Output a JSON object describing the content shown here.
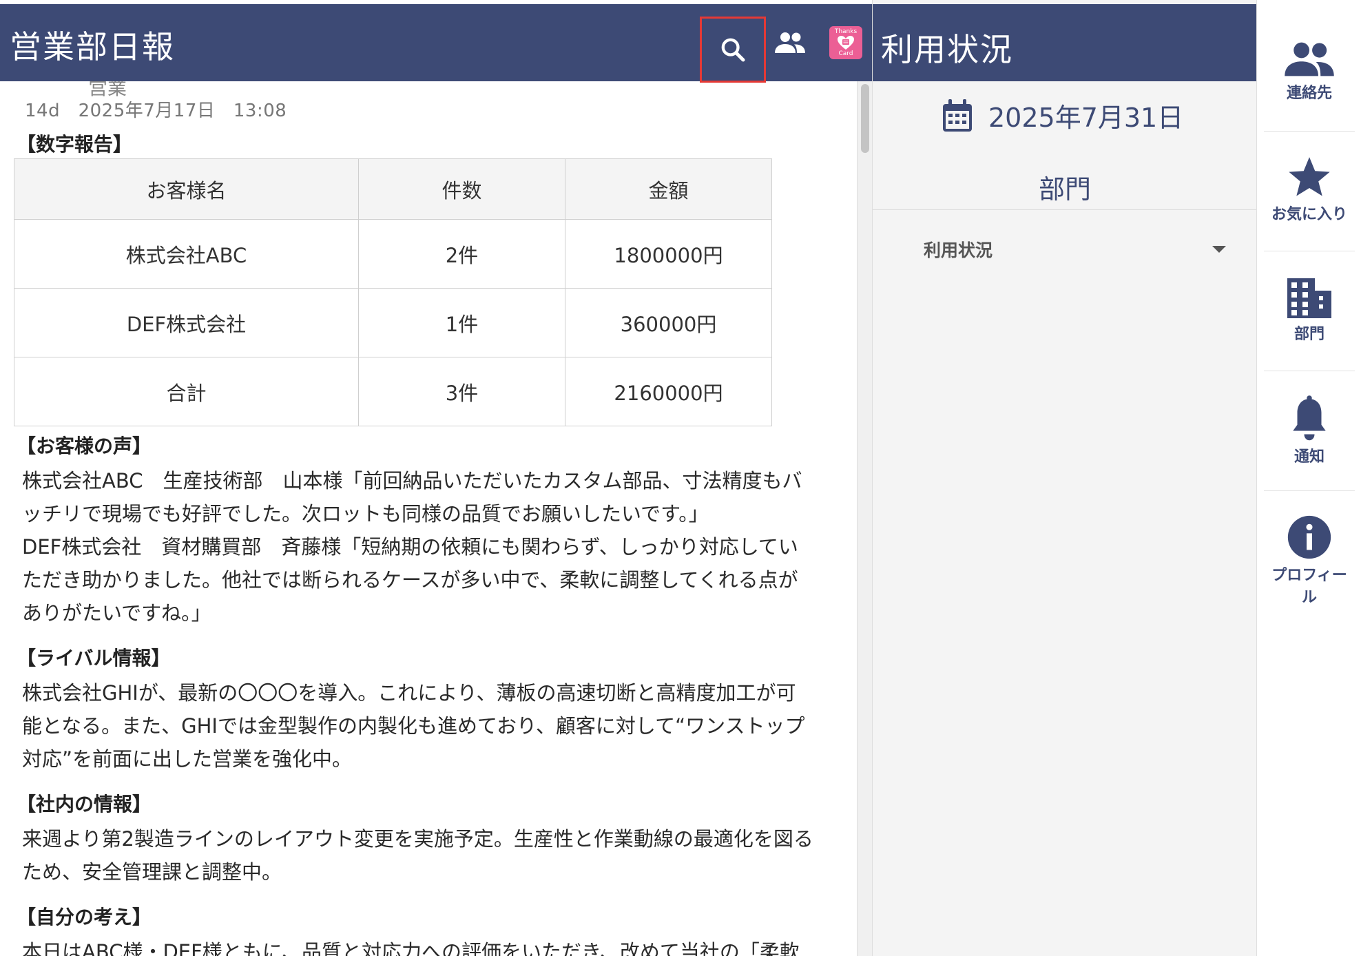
{
  "left": {
    "title": "営業部日報",
    "meta_partial": "営業",
    "meta": "14d　2025年7月17日　13:08",
    "sections": {
      "numbers": "【数字報告】",
      "voice": "【お客様の声】",
      "rival": "【ライバル情報】",
      "internal": "【社内の情報】",
      "opinion": "【自分の考え】"
    },
    "table": {
      "headers": [
        "お客様名",
        "件数",
        "金額"
      ],
      "rows": [
        [
          "株式会社ABC",
          "2件",
          "1800000円"
        ],
        [
          "DEF株式会社",
          "1件",
          "360000円"
        ],
        [
          "合計",
          "3件",
          "2160000円"
        ]
      ]
    },
    "voice_lines": [
      "株式会社ABC　生産技術部　山本様「前回納品いただいたカスタム部品、寸法精度もバ",
      "ッチリで現場でも好評でした。次ロットも同様の品質でお願いしたいです。」",
      "DEF株式会社　資材購買部　斉藤様「短納期の依頼にも関わらず、しっかり対応してい",
      "ただき助かりました。他社では断られるケースが多い中で、柔軟に調整してくれる点が",
      "ありがたいですね。」"
    ],
    "rival_lines": [
      "株式会社GHIが、最新の〇〇〇を導入。これにより、薄板の高速切断と高精度加工が可",
      "能となる。また、GHIでは金型製作の内製化も進めており、顧客に対して“ワンストップ",
      "対応”を前面に出した営業を強化中。"
    ],
    "internal_lines": [
      "来週より第2製造ラインのレイアウト変更を実施予定。生産性と作業動線の最適化を図る",
      "ため、安全管理課と調整中。"
    ],
    "opinion_partial": "本日はABC様・DEF様ともに、品質と対応力への評価をいただき、改めて当社の「柔軟"
  },
  "middle": {
    "title": "利用状況",
    "date": "2025年7月31日",
    "department": "部門",
    "usage_label": "利用状況"
  },
  "nav": {
    "contacts": "連絡先",
    "favorites": "お気に入り",
    "department": "部門",
    "notifications": "通知",
    "profile_line1": "プロフィー",
    "profile_line2": "ル"
  },
  "thanks_card": {
    "line1": "Thanks",
    "line2": "Card"
  },
  "colors": {
    "header": "#3d4a75",
    "accent_border": "#e53935",
    "thanks_pink": "#ec5f95"
  }
}
